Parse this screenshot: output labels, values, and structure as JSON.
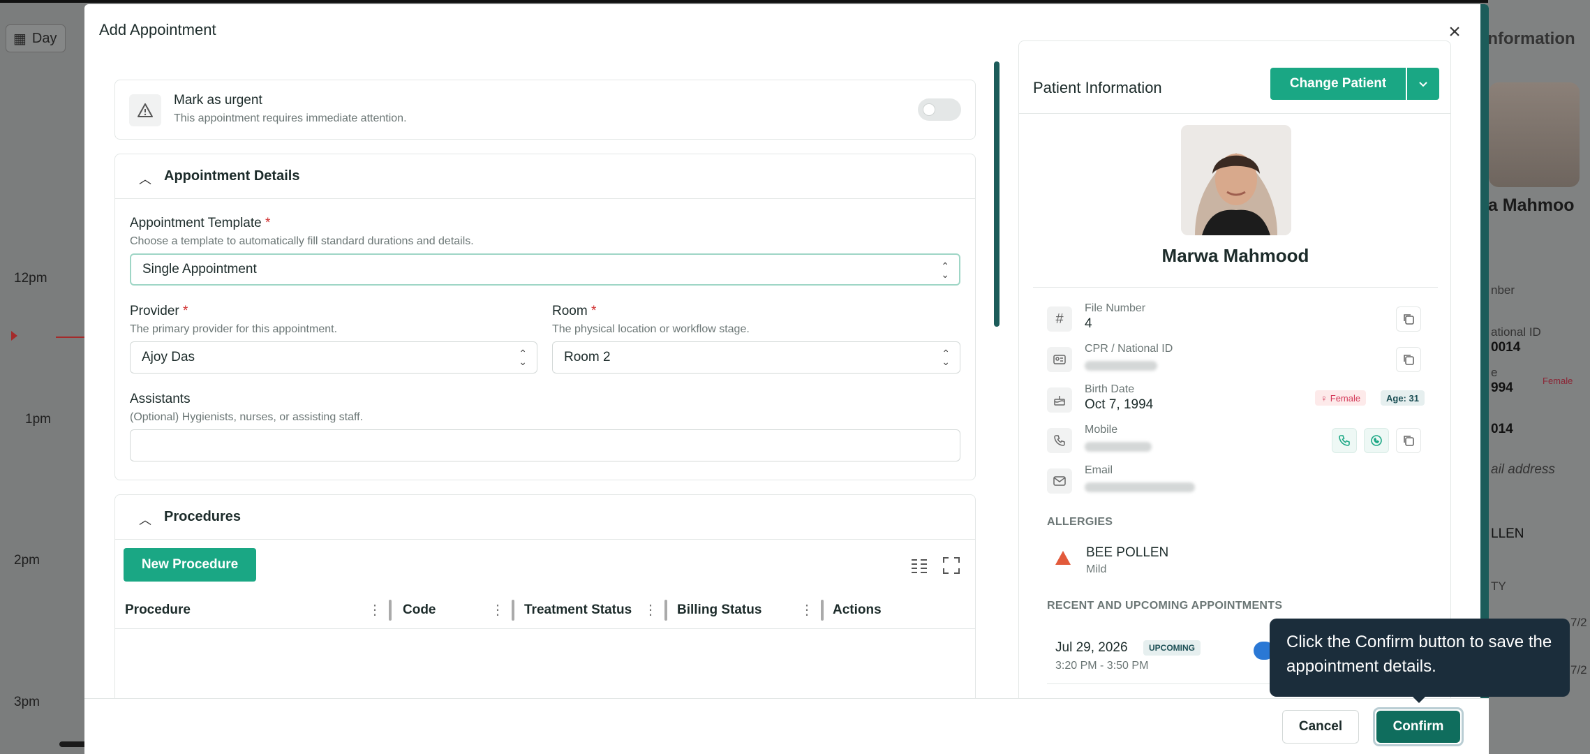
{
  "background": {
    "view_button": "Day",
    "times": [
      "12pm",
      "1pm",
      "2pm",
      "3pm"
    ],
    "right_panel_title": "t Information",
    "right_panel_name": "va Mahmoo",
    "right_labels": [
      "nber",
      "ational ID",
      "0014",
      "e",
      "994",
      "Female",
      "014",
      "ail address",
      "LLEN",
      "TY",
      "7/2",
      "7/2"
    ]
  },
  "modal": {
    "title": "Add Appointment",
    "urgent": {
      "title": "Mark as urgent",
      "subtitle": "This appointment requires immediate attention.",
      "enabled": false
    },
    "details": {
      "section_title": "Appointment Details",
      "template": {
        "label": "Appointment Template",
        "help": "Choose a template to automatically fill standard durations and details.",
        "value": "Single Appointment"
      },
      "provider": {
        "label": "Provider",
        "help": "The primary provider for this appointment.",
        "value": "Ajoy Das"
      },
      "room": {
        "label": "Room",
        "help": "The physical location or workflow stage.",
        "value": "Room 2"
      },
      "assistants": {
        "label": "Assistants",
        "help": "(Optional) Hygienists, nurses, or assisting staff.",
        "value": ""
      },
      "required_mark": "*"
    },
    "procedures": {
      "section_title": "Procedures",
      "new_button": "New Procedure",
      "columns": [
        "Procedure",
        "Code",
        "Treatment Status",
        "Billing Status",
        "Actions"
      ]
    },
    "patient": {
      "panel_title": "Patient Information",
      "change_button": "Change Patient",
      "name": "Marwa Mahmood",
      "file_number_label": "File Number",
      "file_number": "4",
      "cpr_label": "CPR / National ID",
      "birth_label": "Birth Date",
      "birth_date": "Oct 7, 1994",
      "gender": "Female",
      "age": "Age: 31",
      "mobile_label": "Mobile",
      "email_label": "Email",
      "allergies_label": "ALLERGIES",
      "allergy": {
        "name": "BEE POLLEN",
        "severity": "Mild"
      },
      "appointments_label": "RECENT AND UPCOMING APPOINTMENTS",
      "appointment": {
        "date": "Jul 29, 2026",
        "status": "UPCOMING",
        "time": "3:20 PM - 3:50 PM"
      }
    },
    "footer": {
      "cancel": "Cancel",
      "confirm": "Confirm"
    },
    "tooltip": "Click the Confirm button to save the appointment details."
  },
  "colors": {
    "primary": "#1aa784",
    "confirm": "#0f6d5d",
    "tooltip_bg": "#1b2d3b",
    "required": "#d02f2f",
    "allergy": "#e25a3b"
  }
}
